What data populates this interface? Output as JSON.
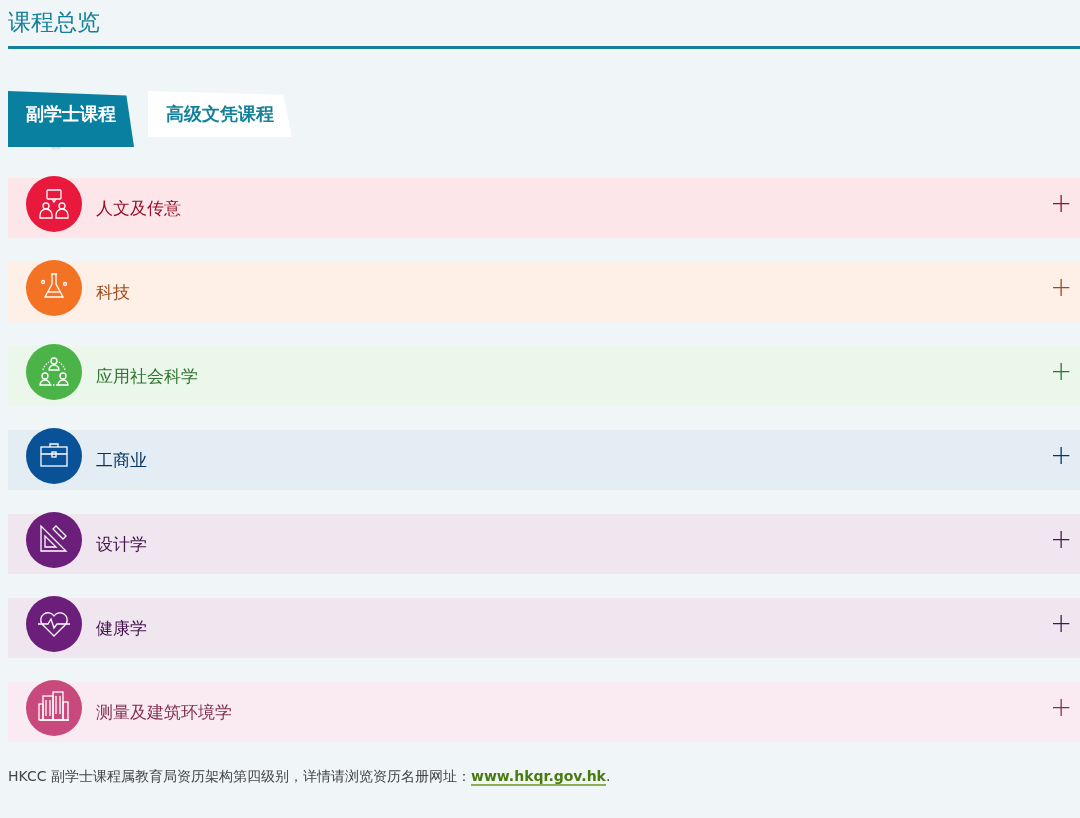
{
  "page_title": "课程总览",
  "tabs": [
    {
      "label": "副学士课程",
      "selected": true
    },
    {
      "label": "高级文凭课程",
      "selected": false
    }
  ],
  "categories": [
    {
      "name": "人文及传意",
      "kind": "people-talk",
      "color": "#e8193c",
      "expanded": false,
      "toggle": "+"
    },
    {
      "name": "科技",
      "kind": "flask",
      "color": "#f47224",
      "expanded": false,
      "toggle": "+"
    },
    {
      "name": "应用社会科学",
      "kind": "network",
      "color": "#4cb349",
      "expanded": false,
      "toggle": "+"
    },
    {
      "name": "工商业",
      "kind": "briefcase",
      "color": "#0a5298",
      "expanded": false,
      "toggle": "+"
    },
    {
      "name": "设计学",
      "kind": "ruler",
      "color": "#6c1f7a",
      "expanded": false,
      "toggle": "+"
    },
    {
      "name": "健康学",
      "kind": "heart",
      "color": "#6c1f7a",
      "expanded": false,
      "toggle": "+"
    },
    {
      "name": "测量及建筑环境学",
      "kind": "buildings",
      "color": "#c84a7c",
      "expanded": false,
      "toggle": "+"
    }
  ],
  "footer": {
    "text": "HKCC 副学士课程属教育局资历架构第四级别，详情请浏览资历名册网址：",
    "link": "www.hkqr.gov.hk",
    "tail": "."
  }
}
